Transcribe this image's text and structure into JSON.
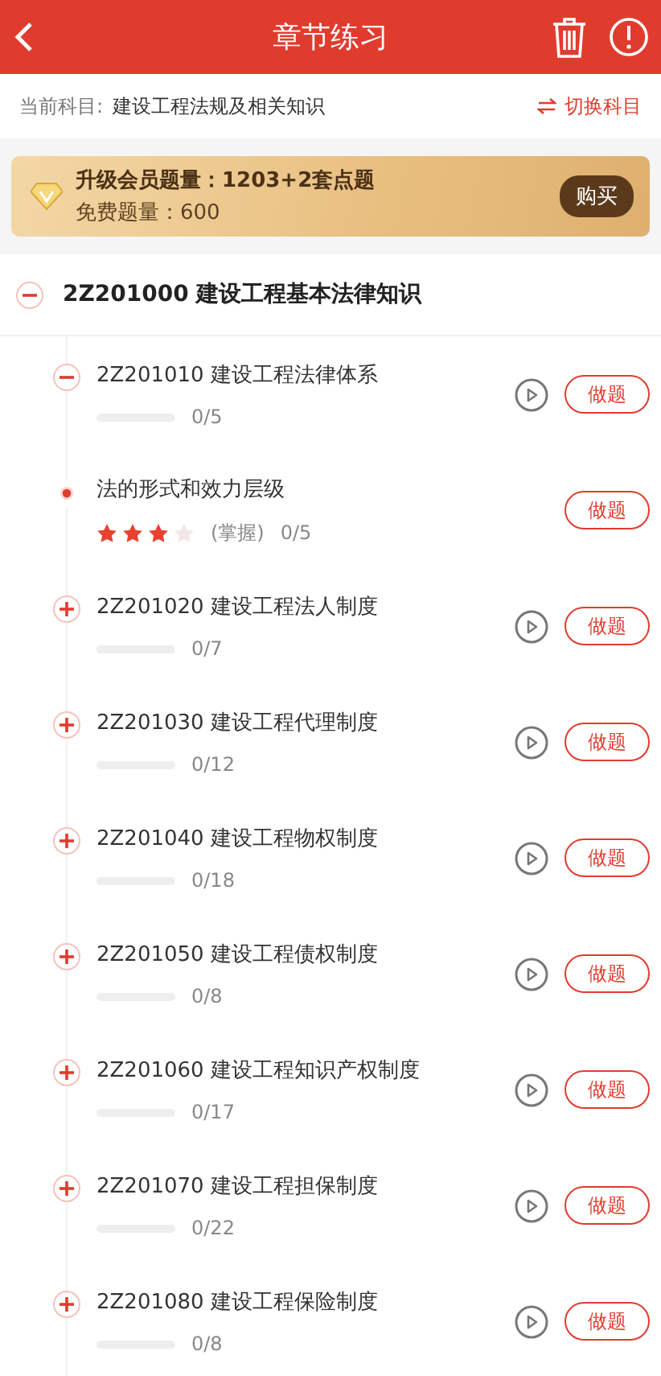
{
  "header": {
    "title": "章节练习"
  },
  "subject": {
    "label": "当前科目:",
    "value": "建设工程法规及相关知识",
    "switch": "切换科目"
  },
  "promo": {
    "title": "升级会员题量：1203+2套点题",
    "free": "免费题量：600",
    "button": "购买"
  },
  "chapter": {
    "title": "2Z201000 建设工程基本法律知识",
    "expanded": true,
    "children": [
      {
        "kind": "section",
        "title": "2Z201010 建设工程法律体系",
        "expanded": true,
        "level": 0,
        "progress": "0/5",
        "button": "做题",
        "children": [
          {
            "kind": "point",
            "title": "法的形式和效力层级",
            "stars": 3,
            "mastery": "(掌握)",
            "progress": "0/5",
            "button": "做题"
          }
        ]
      },
      {
        "kind": "section",
        "title": "2Z201020 建设工程法人制度",
        "expanded": false,
        "level": 0,
        "progress": "0/7",
        "button": "做题"
      },
      {
        "kind": "section",
        "title": "2Z201030 建设工程代理制度",
        "expanded": false,
        "level": 0,
        "progress": "0/12",
        "button": "做题"
      },
      {
        "kind": "section",
        "title": "2Z201040 建设工程物权制度",
        "expanded": false,
        "level": 0,
        "progress": "0/18",
        "button": "做题"
      },
      {
        "kind": "section",
        "title": "2Z201050 建设工程债权制度",
        "expanded": false,
        "level": 0,
        "progress": "0/8",
        "button": "做题"
      },
      {
        "kind": "section",
        "title": "2Z201060 建设工程知识产权制度",
        "expanded": false,
        "level": 0,
        "progress": "0/17",
        "button": "做题"
      },
      {
        "kind": "section",
        "title": "2Z201070 建设工程担保制度",
        "expanded": false,
        "level": 0,
        "progress": "0/22",
        "button": "做题"
      },
      {
        "kind": "section",
        "title": "2Z201080 建设工程保险制度",
        "expanded": false,
        "level": 0,
        "progress": "0/8",
        "button": "做题"
      }
    ]
  }
}
